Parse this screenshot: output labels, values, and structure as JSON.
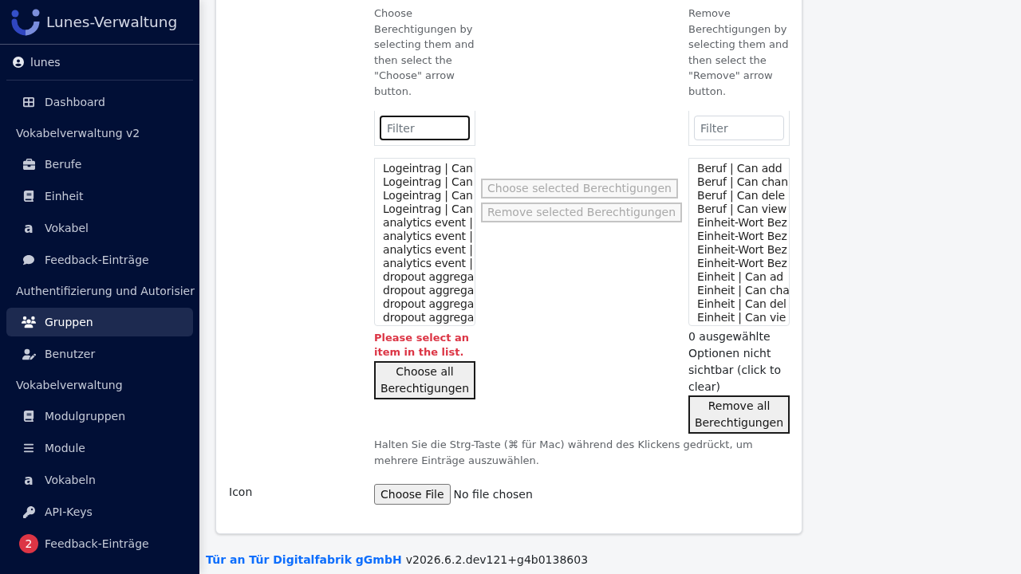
{
  "sidebar": {
    "brand": "Lunes-Verwaltung",
    "user": "lunes",
    "sections": [
      {
        "items": [
          {
            "label": "Dashboard",
            "selected": false
          }
        ]
      },
      {
        "title": "Vokabelverwaltung v2",
        "items": [
          {
            "label": "Berufe",
            "selected": false
          },
          {
            "label": "Einheit",
            "selected": false
          },
          {
            "label": "Vokabel",
            "glyph": "a",
            "selected": false
          },
          {
            "label": "Feedback-Einträge",
            "selected": false
          }
        ]
      },
      {
        "title": "Authentifizierung und Autorisier",
        "items": [
          {
            "label": "Gruppen",
            "selected": true
          },
          {
            "label": "Benutzer",
            "selected": false
          }
        ]
      },
      {
        "title": "Vokabelverwaltung",
        "items": [
          {
            "label": "Modulgruppen",
            "selected": false
          },
          {
            "label": "Module",
            "selected": false
          },
          {
            "label": "Vokabeln",
            "glyph": "a",
            "selected": false
          },
          {
            "label": "API-Keys",
            "selected": false
          },
          {
            "label": "Feedback-Einträge",
            "badge": "2",
            "selected": false
          }
        ]
      }
    ]
  },
  "form": {
    "permissions": {
      "available": {
        "help": "Choose Berechtigungen by selecting them and then select the \"Choose\" arrow button.",
        "filter": {
          "placeholder": "Filter",
          "focused": true
        },
        "options": [
          "Logeintrag | Can",
          "Logeintrag | Can",
          "Logeintrag | Can",
          "Logeintrag | Can",
          "analytics event |",
          "analytics event |",
          "analytics event |",
          "analytics event |",
          "dropout aggrega",
          "dropout aggrega",
          "dropout aggrega",
          "dropout aggrega"
        ],
        "error": "Please select an item in the list.",
        "button": "Choose all Berechtigungen"
      },
      "transfer_buttons": [
        {
          "label": "Choose selected Berechtigungen",
          "disabled": true
        },
        {
          "label": "Remove selected Berechtigungen",
          "disabled": true
        }
      ],
      "chosen": {
        "help": "Remove Berechtigungen by selecting them and then select the \"Remove\" arrow button.",
        "filter": {
          "placeholder": "Filter",
          "focused": false
        },
        "options": [
          "Beruf | Can add",
          "Beruf | Can chan",
          "Beruf | Can dele",
          "Beruf | Can view",
          "Einheit-Wort Bez",
          "Einheit-Wort Bez",
          "Einheit-Wort Bez",
          "Einheit-Wort Bez",
          "Einheit | Can ad",
          "Einheit | Can cha",
          "Einheit | Can del",
          "Einheit | Can vie"
        ],
        "notice": "0 ausgewählte Optionen nicht sichtbar (click to clear)",
        "button": "Remove all Berechtigungen"
      },
      "hint": "Halten Sie die Strg-Taste (⌘ für Mac) während des Klickens gedrückt, um mehrere Einträge auszuwählen."
    },
    "icon_field": {
      "label": "Icon",
      "button": "Choose File",
      "status": "No file chosen"
    }
  },
  "footer": {
    "company": "Tür an Tür Digitalfabrik gGmbH",
    "version": "v2026.6.2.dev121+g4b0138603"
  }
}
